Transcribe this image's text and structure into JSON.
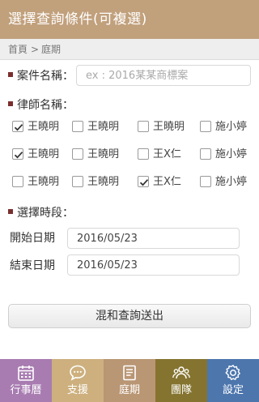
{
  "header": {
    "title": "選擇查詢條件(可複選)"
  },
  "breadcrumb": {
    "home": "首頁",
    "separator": ">",
    "current": "庭期"
  },
  "case_name": {
    "label": "案件名稱：",
    "placeholder": "ex : 2016某某商標案",
    "value": ""
  },
  "lawyers": {
    "label": "律師名稱：",
    "rows": [
      [
        {
          "name": "王曉明",
          "checked": true
        },
        {
          "name": "王曉明",
          "checked": false
        },
        {
          "name": "王曉明",
          "checked": false
        },
        {
          "name": "施小婷",
          "checked": false
        }
      ],
      [
        {
          "name": "王曉明",
          "checked": true
        },
        {
          "name": "王曉明",
          "checked": false
        },
        {
          "name": "王X仁",
          "checked": false
        },
        {
          "name": "施小婷",
          "checked": false
        }
      ],
      [
        {
          "name": "王曉明",
          "checked": false
        },
        {
          "name": "王曉明",
          "checked": false
        },
        {
          "name": "王X仁",
          "checked": true
        },
        {
          "name": "施小婷",
          "checked": false
        }
      ]
    ]
  },
  "period": {
    "label": "選擇時段：",
    "start_label": "開始日期",
    "start_value": "2016/05/23",
    "end_label": "結束日期",
    "end_value": "2016/05/23"
  },
  "submit_label": "混和查詢送出",
  "tabs": [
    {
      "label": "行事曆",
      "icon": "calendar-icon",
      "color": "#a87cb1"
    },
    {
      "label": "支援",
      "icon": "chat-bubble-icon",
      "color": "#cdb07e"
    },
    {
      "label": "庭期",
      "icon": "document-icon",
      "color": "#b99674"
    },
    {
      "label": "團隊",
      "icon": "team-icon",
      "color": "#857430"
    },
    {
      "label": "設定",
      "icon": "gear-icon",
      "color": "#4d76ad"
    }
  ],
  "colors": {
    "header": "#c1a07c",
    "bullet": "#7a2e2e"
  }
}
